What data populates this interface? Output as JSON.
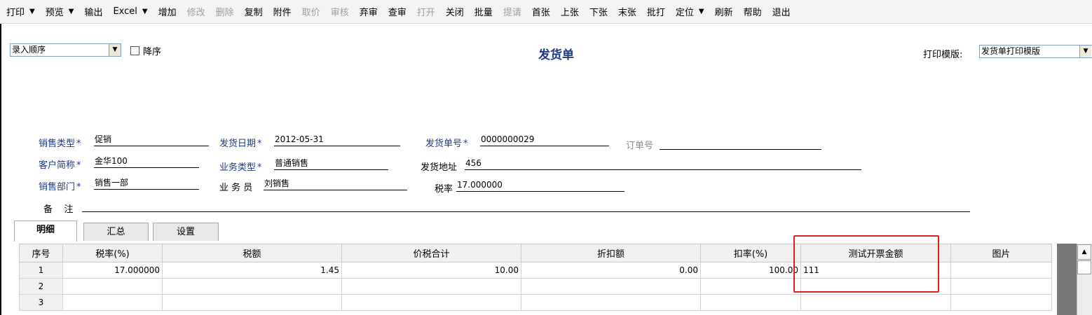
{
  "toolbar": {
    "items": [
      {
        "label": "打印",
        "caret": true,
        "disabled": false
      },
      {
        "label": "预览",
        "caret": true,
        "disabled": false
      },
      {
        "label": "输出",
        "caret": false,
        "disabled": false
      },
      {
        "label": "Excel",
        "caret": true,
        "disabled": false
      },
      {
        "label": "增加",
        "caret": false,
        "disabled": false
      },
      {
        "label": "修改",
        "caret": false,
        "disabled": true
      },
      {
        "label": "删除",
        "caret": false,
        "disabled": true
      },
      {
        "label": "复制",
        "caret": false,
        "disabled": false
      },
      {
        "label": "附件",
        "caret": false,
        "disabled": false
      },
      {
        "label": "取价",
        "caret": false,
        "disabled": true
      },
      {
        "label": "审核",
        "caret": false,
        "disabled": true
      },
      {
        "label": "弃审",
        "caret": false,
        "disabled": false
      },
      {
        "label": "查审",
        "caret": false,
        "disabled": false
      },
      {
        "label": "打开",
        "caret": false,
        "disabled": true
      },
      {
        "label": "关闭",
        "caret": false,
        "disabled": false
      },
      {
        "label": "批量",
        "caret": false,
        "disabled": false
      },
      {
        "label": "提请",
        "caret": false,
        "disabled": true
      },
      {
        "label": "首张",
        "caret": false,
        "disabled": false
      },
      {
        "label": "上张",
        "caret": false,
        "disabled": false
      },
      {
        "label": "下张",
        "caret": false,
        "disabled": false
      },
      {
        "label": "末张",
        "caret": false,
        "disabled": false
      },
      {
        "label": "批打",
        "caret": false,
        "disabled": false
      },
      {
        "label": "定位",
        "caret": true,
        "disabled": false
      },
      {
        "label": "刷新",
        "caret": false,
        "disabled": false
      },
      {
        "label": "帮助",
        "caret": false,
        "disabled": false
      },
      {
        "label": "退出",
        "caret": false,
        "disabled": false
      }
    ],
    "caret_glyph": "▼"
  },
  "sort": {
    "value": "录入顺序",
    "desc_label": "降序"
  },
  "title": "发货单",
  "template": {
    "label": "打印模版:",
    "value": "发货单打印模版"
  },
  "form": {
    "sale_type": {
      "label": "销售类型",
      "value": "促销"
    },
    "ship_date": {
      "label": "发货日期",
      "value": "2012-05-31"
    },
    "ship_no": {
      "label": "发货单号",
      "value": "0000000029"
    },
    "order_no": {
      "label": "订单号",
      "value": ""
    },
    "customer": {
      "label": "客户简称",
      "value": "金华100"
    },
    "biz_type": {
      "label": "业务类型",
      "value": "普通销售"
    },
    "ship_addr": {
      "label": "发货地址",
      "value": "456"
    },
    "dept": {
      "label": "销售部门",
      "value": "销售一部"
    },
    "clerk": {
      "label": "业 务 员",
      "value": "刘销售"
    },
    "tax_rate": {
      "label": "税率",
      "value": "17.000000"
    },
    "remark": {
      "label": "备    注",
      "value": ""
    },
    "required_mark": "*"
  },
  "tabs": [
    "明细",
    "汇总",
    "设置"
  ],
  "grid": {
    "headers": [
      "序号",
      "税率(%)",
      "税额",
      "价税合计",
      "折扣额",
      "扣率(%)",
      "测试开票金额",
      "图片"
    ],
    "rows": [
      [
        "1",
        "17.000000",
        "1.45",
        "10.00",
        "0.00",
        "100.00",
        "111",
        ""
      ],
      [
        "2",
        "",
        "",
        "",
        "",
        "",
        "",
        ""
      ],
      [
        "3",
        "",
        "",
        "",
        "",
        "",
        "",
        ""
      ]
    ]
  },
  "colors": {
    "label_blue": "#1f3a8a",
    "highlight_red": "#e02020"
  },
  "icons": {
    "caret": "chevron-down-icon",
    "scroll_up": "scroll-up-arrow-icon",
    "checkbox": "checkbox-icon"
  }
}
